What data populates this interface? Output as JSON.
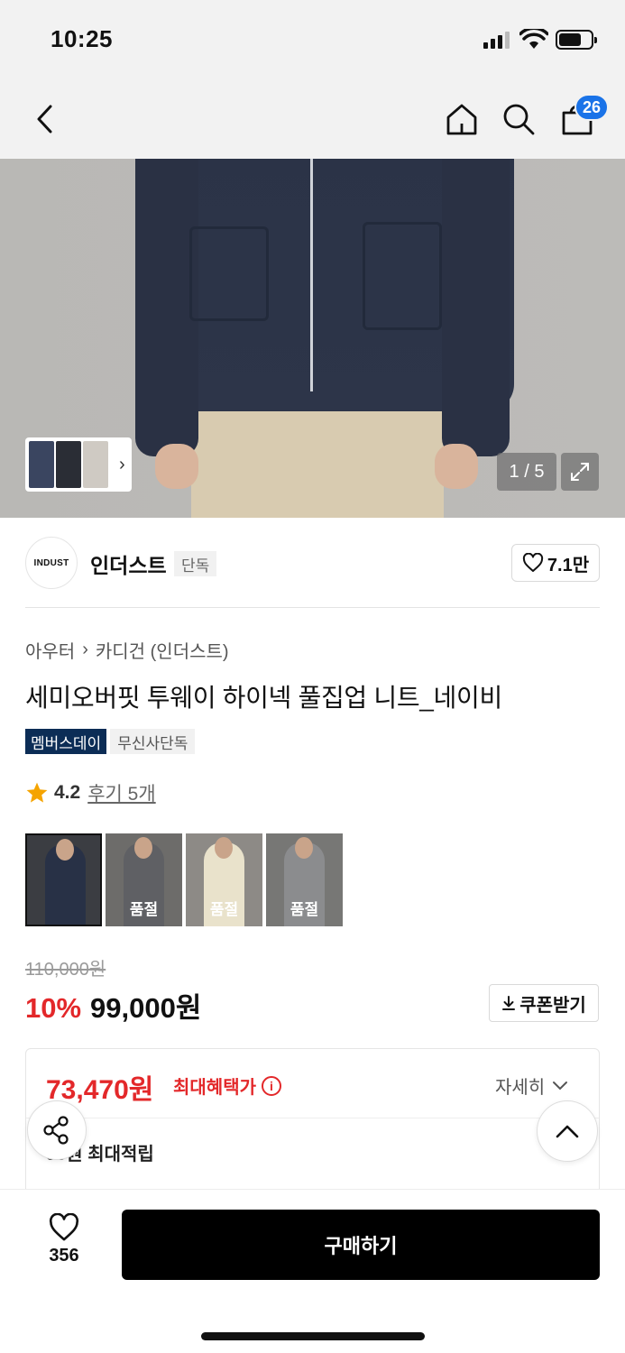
{
  "status_bar": {
    "time": "10:25"
  },
  "header": {
    "cart_count": "26"
  },
  "gallery": {
    "counter": "1 / 5"
  },
  "brand": {
    "logo_text": "INDUST",
    "name": "인더스트",
    "tag": "단독",
    "likes": "7.1만"
  },
  "product": {
    "breadcrumb": [
      "아우터",
      "카디건 (인더스트)"
    ],
    "title": "세미오버핏 투웨이 하이넥 풀집업 니트_네이비",
    "tags": [
      "멤버스데이",
      "무신사단독"
    ],
    "rating": "4.2",
    "review_link": "후기 5개"
  },
  "options": [
    {
      "color": "#283146",
      "soldout": ""
    },
    {
      "color": "#5f6064",
      "soldout": "품절"
    },
    {
      "color": "#e9e2cb",
      "soldout": "품절"
    },
    {
      "color": "#8b8c8e",
      "soldout": "품절"
    }
  ],
  "price": {
    "original": "110,000원",
    "discount": "10%",
    "sale": "99,000원",
    "coupon_label": "쿠폰받기"
  },
  "benefit": {
    "price": "73,470원",
    "label": "최대혜택가",
    "detail_label": "자세히",
    "points": "50원 최대적립"
  },
  "bottom_bar": {
    "like_count": "356",
    "buy_label": "구매하기"
  },
  "colors": {
    "accent_red": "#e3282a",
    "badge_blue": "#1a73e8",
    "member_tag": "#0c2d56"
  }
}
